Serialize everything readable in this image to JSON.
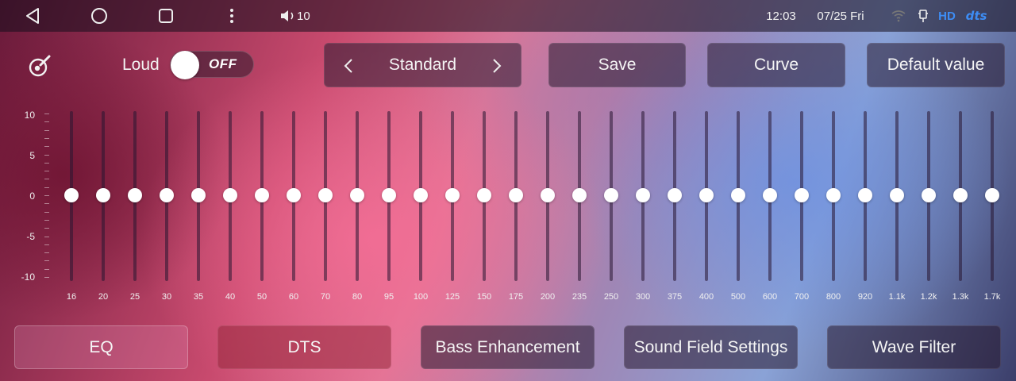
{
  "statusbar": {
    "volume": "10",
    "time": "12:03",
    "date": "07/25 Fri",
    "hd": "HD",
    "dts_logo": "dts",
    "icons": [
      "back-icon",
      "home-icon",
      "recents-icon",
      "more-vert-icon",
      "volume-icon",
      "wifi-off-icon",
      "usb-icon"
    ]
  },
  "controls": {
    "loud_label": "Loud",
    "loud_state": "OFF",
    "preset_name": "Standard",
    "save_label": "Save",
    "curve_label": "Curve",
    "default_label": "Default value"
  },
  "eq": {
    "scale": [
      "10",
      "5",
      "0",
      "-5",
      "-10"
    ],
    "range": [
      -10,
      10
    ],
    "bands": [
      {
        "freq": "16",
        "value": 0
      },
      {
        "freq": "20",
        "value": 0
      },
      {
        "freq": "25",
        "value": 0
      },
      {
        "freq": "30",
        "value": 0
      },
      {
        "freq": "35",
        "value": 0
      },
      {
        "freq": "40",
        "value": 0
      },
      {
        "freq": "50",
        "value": 0
      },
      {
        "freq": "60",
        "value": 0
      },
      {
        "freq": "70",
        "value": 0
      },
      {
        "freq": "80",
        "value": 0
      },
      {
        "freq": "95",
        "value": 0
      },
      {
        "freq": "100",
        "value": 0
      },
      {
        "freq": "125",
        "value": 0
      },
      {
        "freq": "150",
        "value": 0
      },
      {
        "freq": "175",
        "value": 0
      },
      {
        "freq": "200",
        "value": 0
      },
      {
        "freq": "235",
        "value": 0
      },
      {
        "freq": "250",
        "value": 0
      },
      {
        "freq": "300",
        "value": 0
      },
      {
        "freq": "375",
        "value": 0
      },
      {
        "freq": "400",
        "value": 0
      },
      {
        "freq": "500",
        "value": 0
      },
      {
        "freq": "600",
        "value": 0
      },
      {
        "freq": "700",
        "value": 0
      },
      {
        "freq": "800",
        "value": 0
      },
      {
        "freq": "920",
        "value": 0
      },
      {
        "freq": "1.1k",
        "value": 0
      },
      {
        "freq": "1.2k",
        "value": 0
      },
      {
        "freq": "1.3k",
        "value": 0
      },
      {
        "freq": "1.7k",
        "value": 0
      }
    ]
  },
  "tabs": [
    {
      "label": "EQ",
      "active": true
    },
    {
      "label": "DTS",
      "active": false
    },
    {
      "label": "Bass Enhancement",
      "active": false
    },
    {
      "label": "Sound Field Settings",
      "active": false
    },
    {
      "label": "Wave Filter",
      "active": false
    }
  ],
  "colors": {
    "accent_blue": "#3d8df5",
    "knob": "#ffffff"
  }
}
